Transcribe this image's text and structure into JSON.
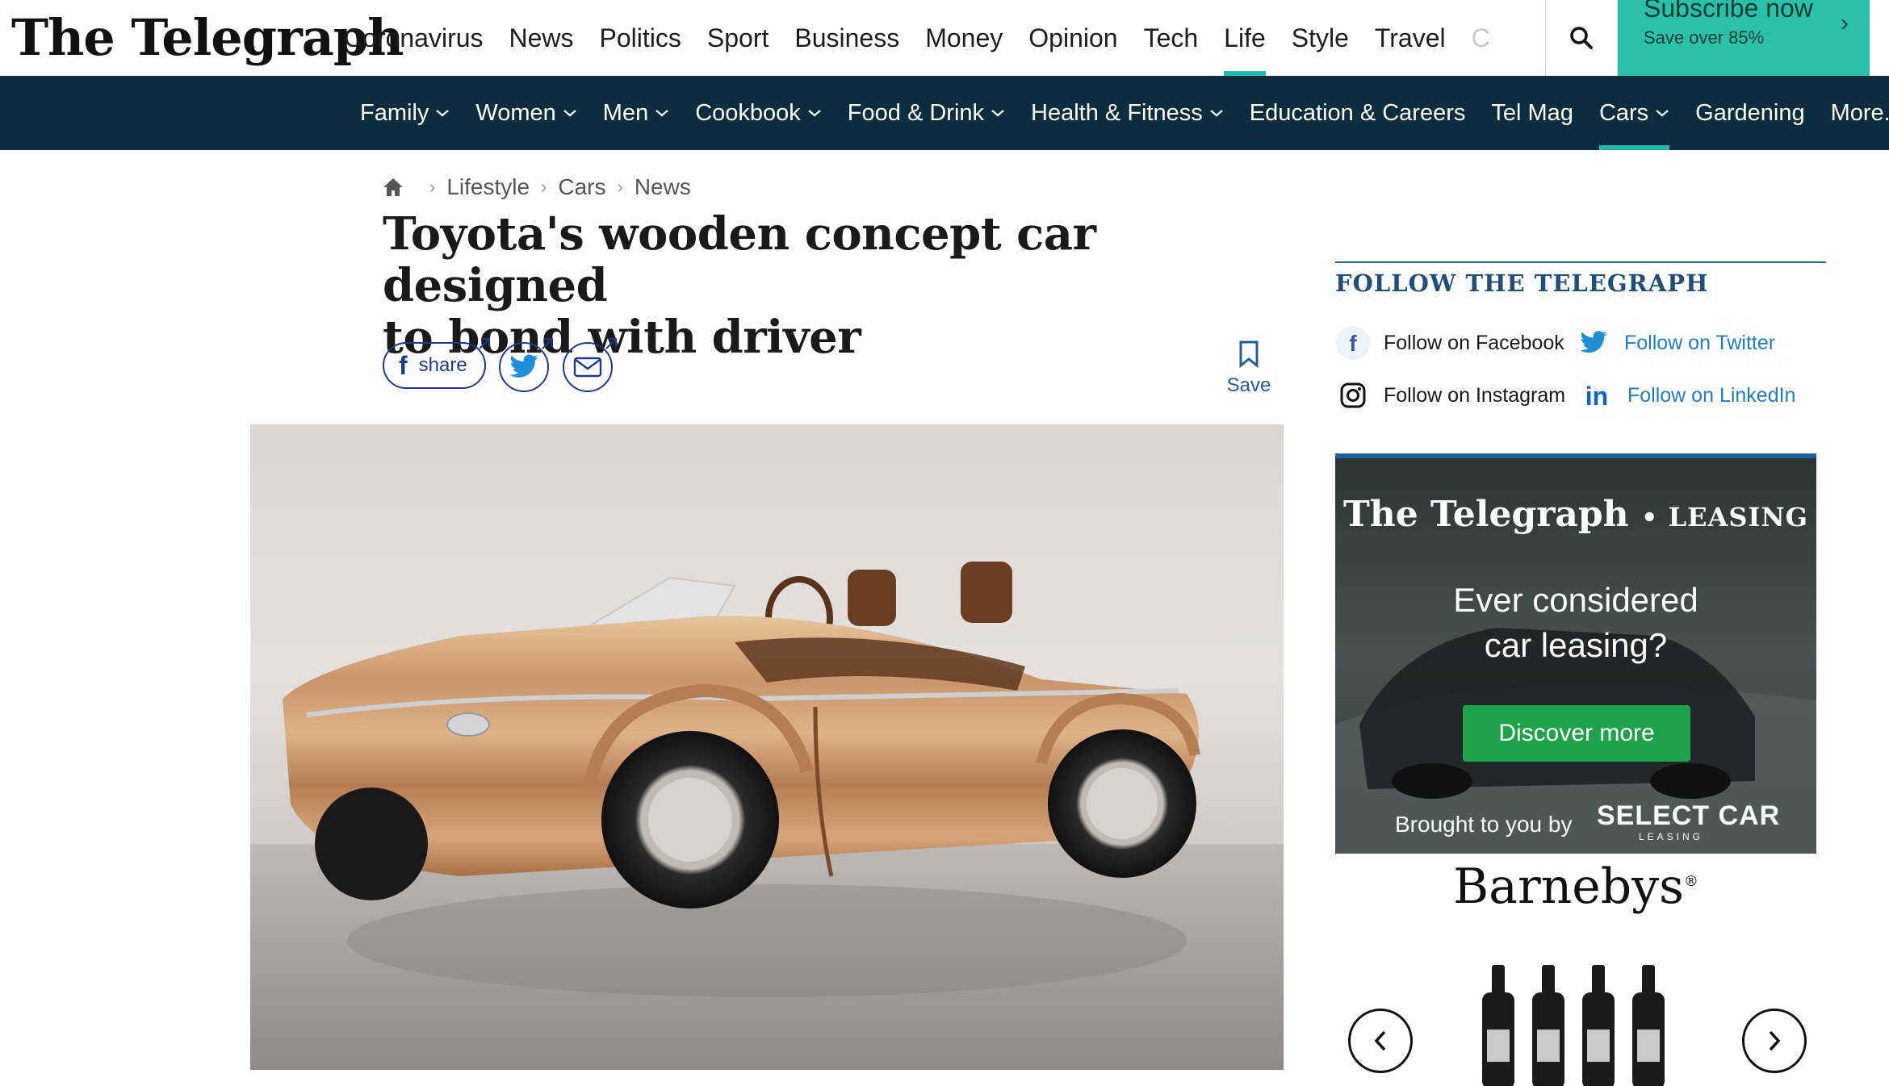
{
  "brand": {
    "logo_text": "The Telegraph"
  },
  "primary_nav": [
    {
      "label": "Coronavirus"
    },
    {
      "label": "News"
    },
    {
      "label": "Politics"
    },
    {
      "label": "Sport"
    },
    {
      "label": "Business"
    },
    {
      "label": "Money"
    },
    {
      "label": "Opinion"
    },
    {
      "label": "Tech"
    },
    {
      "label": "Life",
      "active": true
    },
    {
      "label": "Style"
    },
    {
      "label": "Travel"
    },
    {
      "label": "C"
    }
  ],
  "subscribe": {
    "title": "Subscribe now",
    "subtitle": "Save over 85%"
  },
  "secondary_nav": [
    {
      "label": "Family",
      "dropdown": true
    },
    {
      "label": "Women",
      "dropdown": true
    },
    {
      "label": "Men",
      "dropdown": true
    },
    {
      "label": "Cookbook",
      "dropdown": true
    },
    {
      "label": "Food & Drink",
      "dropdown": true
    },
    {
      "label": "Health & Fitness",
      "dropdown": true
    },
    {
      "label": "Education & Careers",
      "dropdown": false
    },
    {
      "label": "Tel Mag",
      "dropdown": false
    },
    {
      "label": "Cars",
      "dropdown": true,
      "active": true
    },
    {
      "label": "Gardening",
      "dropdown": false
    },
    {
      "label": "More...",
      "dropdown": false
    }
  ],
  "breadcrumb": [
    "Lifestyle",
    "Cars",
    "News"
  ],
  "article": {
    "headline_line1": "Toyota's wooden concept car designed",
    "headline_line2": "to bond with driver",
    "share_label": "share",
    "save_label": "Save"
  },
  "follow": {
    "title": "FOLLOW THE TELEGRAPH",
    "facebook": "Follow on Facebook",
    "twitter": "Follow on Twitter",
    "instagram": "Follow on Instagram",
    "linkedin": "Follow on LinkedIn"
  },
  "ad": {
    "brand": "The Telegraph",
    "brand_suffix": "• LEASING",
    "headline_line1": "Ever considered",
    "headline_line2": "car leasing?",
    "cta": "Discover more",
    "brought_by": "Brought to you by",
    "sponsor": "SELECT CAR",
    "sponsor_sub": "LEASING"
  },
  "barnebys": {
    "logo_text": "Barnebys"
  },
  "colors": {
    "accent_teal": "#24b8a8",
    "subscribe_bg": "#2bc0a8",
    "secondary_nav_bg": "#0b2d3e",
    "link_blue": "#1f5f9a",
    "follow_title": "#1f4e79",
    "ad_cta_green": "#1fa34a"
  }
}
